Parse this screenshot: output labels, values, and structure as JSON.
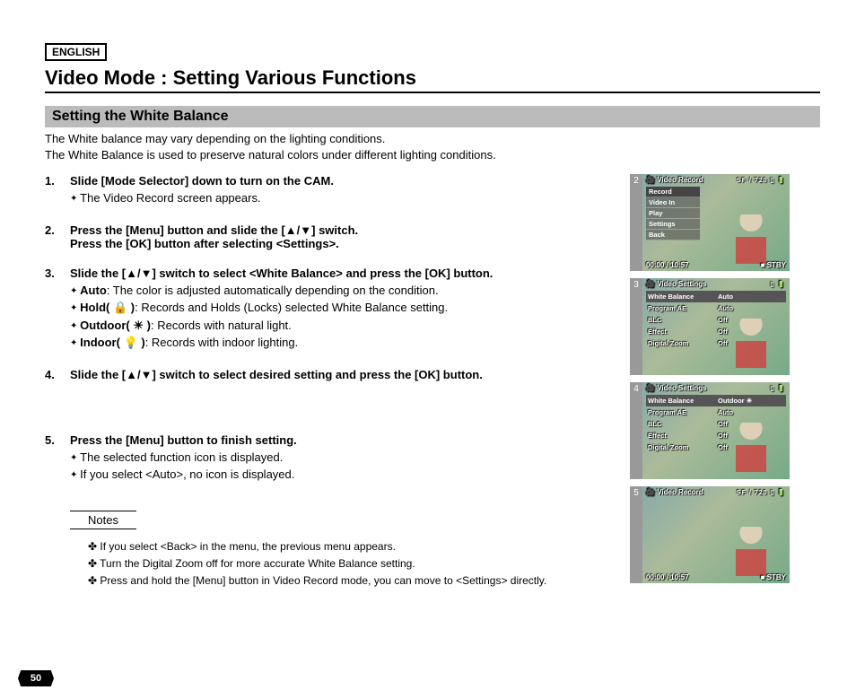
{
  "language": "ENGLISH",
  "title": "Video Mode : Setting Various Functions",
  "section": "Setting the White Balance",
  "intro1": "The White balance may vary depending on the lighting conditions.",
  "intro2": "The White Balance is used to preserve natural colors under different lighting conditions.",
  "steps": {
    "s1": {
      "num": "1.",
      "head": "Slide [Mode Selector] down to turn on the CAM.",
      "sub1": "The Video Record screen appears."
    },
    "s2": {
      "num": "2.",
      "head1": "Press the [Menu] button and slide the [▲/▼] switch.",
      "head2": "Press the [OK] button after selecting <Settings>."
    },
    "s3": {
      "num": "3.",
      "head": "Slide the [▲/▼] switch to select <White Balance> and press the [OK] button.",
      "opt1label": "Auto",
      "opt1text": ": The color is adjusted automatically depending on the condition.",
      "opt2label": "Hold( 🔒 )",
      "opt2text": ": Records and Holds (Locks) selected White Balance setting.",
      "opt3label": "Outdoor( ☀ )",
      "opt3text": ": Records with natural light.",
      "opt4label": "Indoor( 💡 )",
      "opt4text": ": Records with indoor lighting."
    },
    "s4": {
      "num": "4.",
      "head": "Slide the [▲/▼] switch to select desired setting and press the [OK] button."
    },
    "s5": {
      "num": "5.",
      "head": "Press the [Menu] button to finish setting.",
      "sub1": "The selected function icon is displayed.",
      "sub2": "If you select <Auto>, no icon is displayed."
    }
  },
  "notesLabel": "Notes",
  "notes": {
    "n1": "If you select <Back> in the menu, the previous menu appears.",
    "n2": "Turn the Digital Zoom off for more accurate White Balance setting.",
    "n3": "Press and hold the [Menu] button in Video Record mode, you can move to <Settings> directly."
  },
  "pageNum": "50",
  "thumbs": {
    "t2": {
      "num": "2",
      "topTitle": "Video Record",
      "topBadge": "SF / 720",
      "menu": [
        "Record",
        "Video In",
        "Play",
        "Settings",
        "Back"
      ],
      "time": "00:00 / 10:57",
      "status": "STBY"
    },
    "t3": {
      "num": "3",
      "topTitle": "Video Settings",
      "rows": [
        [
          "White Balance",
          "Auto"
        ],
        [
          "Program AE",
          "Auto"
        ],
        [
          "BLC",
          "Off"
        ],
        [
          "Effect",
          "Off"
        ],
        [
          "Digital Zoom",
          "Off"
        ]
      ]
    },
    "t4": {
      "num": "4",
      "topTitle": "Video Settings",
      "rows": [
        [
          "White Balance",
          "Outdoor"
        ],
        [
          "Program AE",
          "Auto"
        ],
        [
          "BLC",
          "Off"
        ],
        [
          "Effect",
          "Off"
        ],
        [
          "Digital Zoom",
          "Off"
        ]
      ],
      "icon": "☀"
    },
    "t5": {
      "num": "5",
      "topTitle": "Video Record",
      "topBadge": "SF / 720",
      "time": "00:00 / 10:57",
      "status": "STBY"
    }
  }
}
